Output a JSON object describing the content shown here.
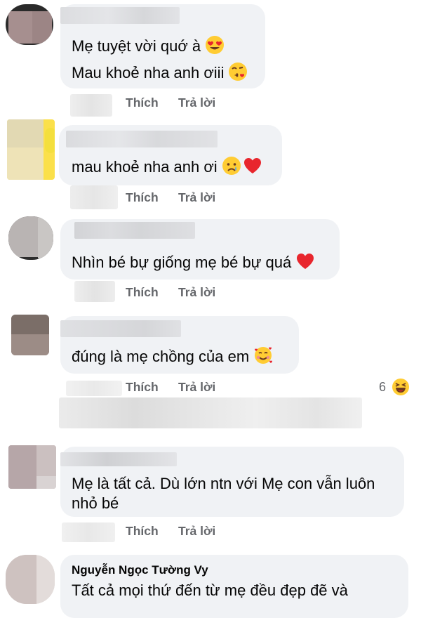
{
  "comments": [
    {
      "lines": [
        "Mẹ tuyệt vời quớ à",
        "Mau khoẻ nha anh ơiii"
      ],
      "emojis": [
        "heart-eyes",
        "kissing"
      ]
    },
    {
      "lines": [
        "mau khoẻ nha anh ơi"
      ],
      "emojis": [
        "crying",
        "red-heart"
      ]
    },
    {
      "lines": [
        "Nhìn bé bự giống mẹ bé bự quá"
      ],
      "emojis": [
        "red-heart"
      ]
    },
    {
      "lines": [
        "đúng là mẹ chồng của em"
      ],
      "emojis": [
        "smiling-hearts"
      ],
      "reaction_count": "6",
      "reaction_icon": "laughing"
    },
    {
      "lines": [
        "Mẹ là tất cả. Dù lớn ntn với Mẹ con vẫn luôn",
        "nhỏ bé"
      ]
    },
    {
      "author": "Nguyễn Ngọc Tường Vy",
      "lines": [
        "Tất cả mọi thứ đến từ mẹ đều đẹp đẽ và"
      ]
    }
  ],
  "actions": {
    "like_label": "Thích",
    "reply_label": "Trả lời"
  },
  "colors": {
    "bubble": "#f0f2f5",
    "action_text": "#65676b",
    "heart": "#e8262d",
    "emoji_yellow": "#ffcc33"
  }
}
